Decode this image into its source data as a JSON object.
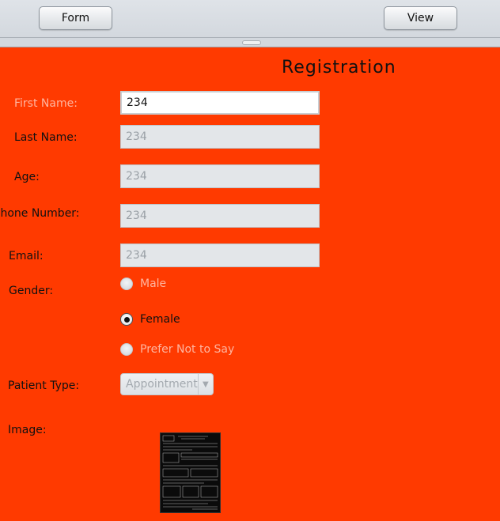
{
  "toolbar": {
    "form_label": "Form",
    "view_label": "View"
  },
  "form": {
    "title": "Registration",
    "fields": {
      "first_name": {
        "label": "First Name:",
        "value": "234"
      },
      "last_name": {
        "label": "Last Name:",
        "value": "234"
      },
      "age": {
        "label": "Age:",
        "value": "234"
      },
      "phone": {
        "label": "Phone Number:",
        "value": "234"
      },
      "email": {
        "label": "Email:",
        "value": "234"
      }
    },
    "gender": {
      "label": "Gender:",
      "options": [
        "Male",
        "Female",
        "Prefer Not to Say"
      ],
      "selected": "Female"
    },
    "patient_type": {
      "label": "Patient Type:",
      "value": "Appointment"
    },
    "image": {
      "label": "Image:"
    }
  },
  "colors": {
    "panel_background": "#ff3a00",
    "toolbar_background": "#d8dde2"
  }
}
